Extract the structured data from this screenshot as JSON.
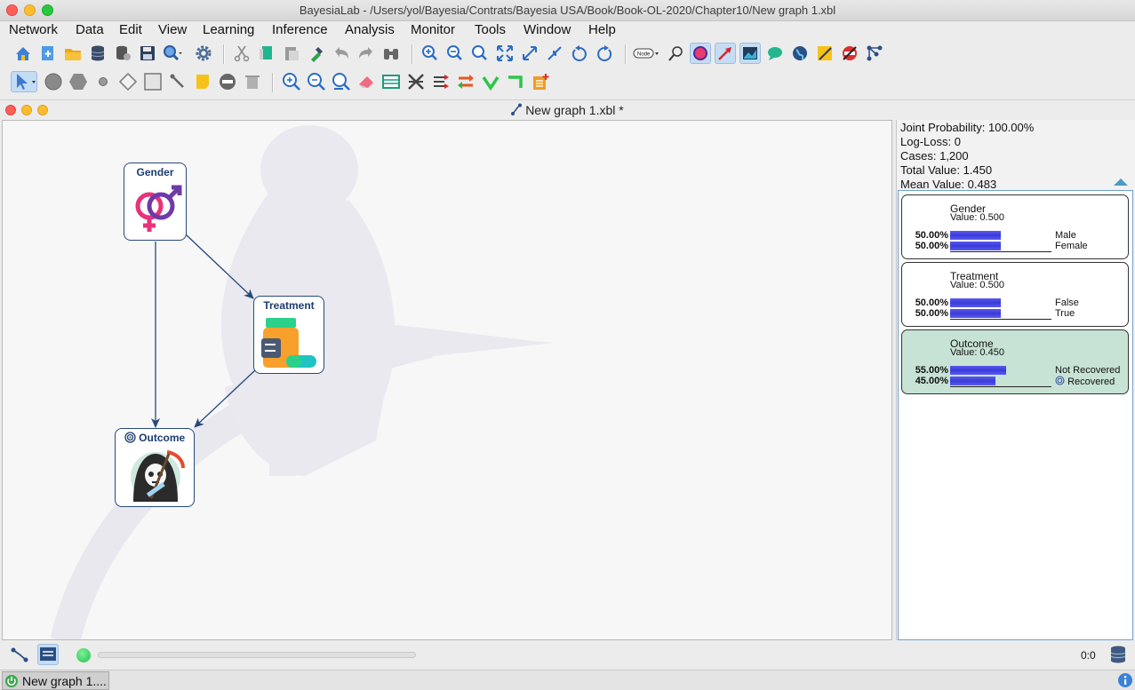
{
  "window": {
    "title": "BayesiaLab - /Users/yol/Bayesia/Contrats/Bayesia USA/Book/Book-OL-2020/Chapter10/New graph 1.xbl"
  },
  "menu": [
    "Network",
    "Data",
    "Edit",
    "View",
    "Learning",
    "Inference",
    "Analysis",
    "Monitor",
    "Tools",
    "Window",
    "Help"
  ],
  "toolbar1_icons": [
    "home-icon",
    "new-network-icon",
    "open-folder-icon",
    "database-icon",
    "database-export-icon",
    "save-icon",
    "search-icon",
    "settings-icon",
    "cut-icon",
    "copy-icon",
    "paste-icon",
    "format-painter-icon",
    "undo-icon",
    "redo-icon",
    "binoculars-icon",
    "zoom-in-icon",
    "zoom-out-icon",
    "zoom-fit-icon",
    "fit-screen-icon",
    "expand-icon",
    "collapse-icon",
    "rotate-left-icon",
    "rotate-right-icon",
    "node-display-icon",
    "pin-icon",
    "node-circle-icon",
    "arc-icon",
    "chart-icon",
    "comment-icon",
    "globe-icon",
    "note-icon",
    "forbidden-arc-icon",
    "network-icon"
  ],
  "toolbar2_icons": [
    "select-arrow-icon",
    "circle-node-icon",
    "hexagon-node-icon",
    "small-node-icon",
    "diamond-node-icon",
    "square-node-icon",
    "arc-tool-icon",
    "note-tool-icon",
    "minus-node-icon",
    "trash-icon",
    "zoom-node-icon",
    "zoom-out-node-icon",
    "zoom-select-icon",
    "eraser-icon",
    "table-icon",
    "arc-remove-icon",
    "arrows-icon",
    "swap-arcs-icon",
    "check-icon",
    "corner-arrow-icon",
    "report-icon"
  ],
  "node_button_label": "Node",
  "graph_window": {
    "title": "New graph 1.xbl *"
  },
  "nodes": {
    "gender": {
      "label": "Gender"
    },
    "treatment": {
      "label": "Treatment"
    },
    "outcome": {
      "label": "Outcome"
    }
  },
  "stats": {
    "joint_probability": "Joint Probability: 100.00%",
    "log_loss": "Log-Loss: 0",
    "cases": "Cases: 1,200",
    "total_value": "Total Value: 1.450",
    "mean_value": "Mean Value: 0.483"
  },
  "monitors": [
    {
      "name": "Gender",
      "value": "Value: 0.500",
      "states": [
        {
          "pct": "50.00%",
          "label": "Male",
          "p": 0.5
        },
        {
          "pct": "50.00%",
          "label": "Female",
          "p": 0.5
        }
      ]
    },
    {
      "name": "Treatment",
      "value": "Value: 0.500",
      "states": [
        {
          "pct": "50.00%",
          "label": "False",
          "p": 0.5
        },
        {
          "pct": "50.00%",
          "label": "True",
          "p": 0.5
        }
      ]
    },
    {
      "name": "Outcome",
      "value": "Value: 0.450",
      "states": [
        {
          "pct": "55.00%",
          "label": "Not Recovered",
          "p": 0.55
        },
        {
          "pct": "45.00%",
          "label": "Recovered",
          "p": 0.45
        }
      ]
    }
  ],
  "status": {
    "coords": "0:0"
  },
  "taskbar": {
    "item": "New graph 1...."
  },
  "colors": {
    "node_border": "#27497a",
    "bar": "#4343e0",
    "target_monitor": "#c7e3d5"
  }
}
